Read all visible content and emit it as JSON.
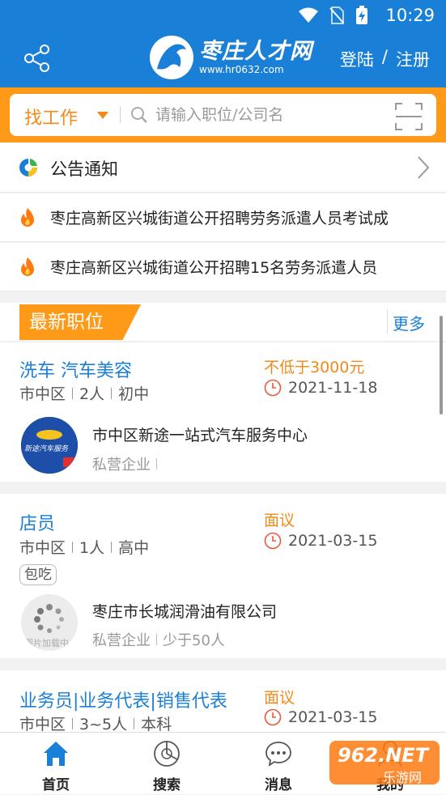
{
  "status": {
    "time": "10:29"
  },
  "header": {
    "site_name": "枣庄人才网",
    "site_url": "www.hr0632.com",
    "login": "登陆",
    "divider": "/",
    "register": "注册"
  },
  "search": {
    "category": "找工作",
    "placeholder": "请输入职位/公司名"
  },
  "notice": {
    "title": "公告通知"
  },
  "news": [
    {
      "text": "枣庄高新区兴城街道公开招聘劳务派遣人员考试成"
    },
    {
      "text": "枣庄高新区兴城街道公开招聘15名劳务派遣人员"
    }
  ],
  "latest": {
    "title": "最新职位",
    "more": "更多"
  },
  "jobs": [
    {
      "title": "洗车  汽车美容",
      "salary": "不低于3000元",
      "location": "市中区",
      "count": "2人",
      "education": "初中",
      "date": "2021-11-18",
      "company": "市中区新途一站式汽车服务中心",
      "company_type": "私营企业",
      "company_size": "",
      "logo_text": "新途汽车服务"
    },
    {
      "title": "店员",
      "salary": "面议",
      "location": "市中区",
      "count": "1人",
      "education": "高中",
      "date": "2021-03-15",
      "perk": "包吃",
      "company": "枣庄市长城润滑油有限公司",
      "company_type": "私营企业",
      "company_size": "少于50人",
      "logo_text": "图片加载中"
    },
    {
      "title": "业务员|业务代表|销售代表",
      "salary": "面议",
      "location": "市中区",
      "count": "3~5人",
      "education": "本科",
      "date": "2021-03-15"
    }
  ],
  "nav": [
    {
      "label": "首页"
    },
    {
      "label": "搜索"
    },
    {
      "label": "消息"
    },
    {
      "label": "我的"
    }
  ],
  "watermark": {
    "text": "962.NET",
    "sub": "乐游网"
  },
  "colors": {
    "primary": "#1a7fd6",
    "accent": "#ff9a18"
  }
}
